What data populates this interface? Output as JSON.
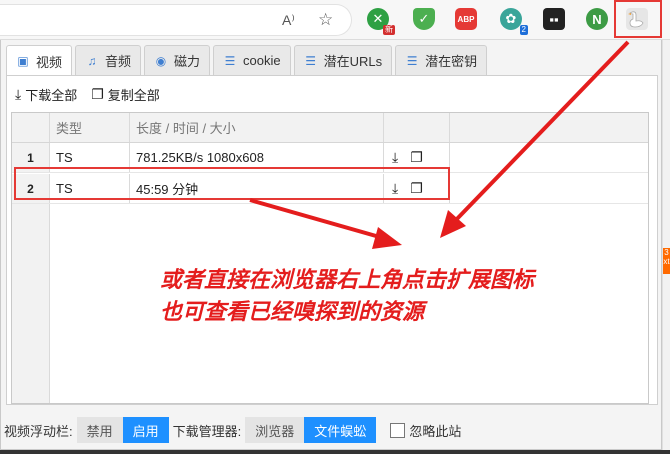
{
  "browser": {
    "read_aloud_label": "A⁾",
    "ext_badge_new": "新",
    "ext_abp_label": "ABP",
    "ext_badge_count": "2",
    "ext_n_label": "N"
  },
  "tabs": [
    {
      "label": "视频",
      "icon": "save-icon"
    },
    {
      "label": "音频",
      "icon": "music-note-icon"
    },
    {
      "label": "磁力",
      "icon": "globe-icon"
    },
    {
      "label": "cookie",
      "icon": "document-icon"
    },
    {
      "label": "潜在URLs",
      "icon": "document-icon"
    },
    {
      "label": "潜在密钥",
      "icon": "document-icon"
    }
  ],
  "actions": {
    "download_all": "下载全部",
    "copy_all": "复制全部"
  },
  "table": {
    "headers": {
      "type": "类型",
      "info": "长度 / 时间 / 大小"
    },
    "rows": [
      {
        "num": "1",
        "type": "TS",
        "info": "781.25KB/s 1080x608"
      },
      {
        "num": "2",
        "type": "TS",
        "info": "45:59 分钟"
      }
    ]
  },
  "footer": {
    "float_bar_label": "视频浮动栏:",
    "disable": "禁用",
    "enable": "启用",
    "dl_manager_label": "下载管理器:",
    "browser": "浏览器",
    "file_centipede": "文件蜈蚣",
    "ignore_site": "忽略此站"
  },
  "annotation": {
    "line1": "或者直接在浏览器右上角点击扩展图标",
    "line2": "也可查看已经嗅探到的资源"
  },
  "colors": {
    "accent": "#1e90ff",
    "annotation": "#e41d1d"
  }
}
